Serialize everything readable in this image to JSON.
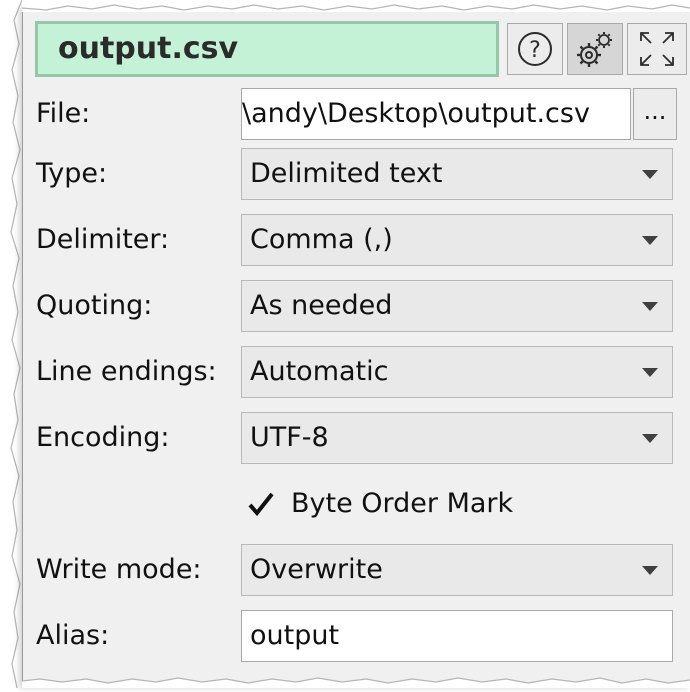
{
  "title": "output.csv",
  "toolbar": {
    "help_icon": "help-circle-icon",
    "settings_icon": "gears-icon",
    "expand_icon": "expand-arrows-icon"
  },
  "rows": {
    "file": {
      "label": "File:",
      "value": "\\andy\\Desktop\\output.csv",
      "browse": "..."
    },
    "type": {
      "label": "Type:",
      "value": "Delimited text"
    },
    "delimiter": {
      "label": "Delimiter:",
      "value": "Comma (,)"
    },
    "quoting": {
      "label": "Quoting:",
      "value": "As needed"
    },
    "line_endings": {
      "label": "Line endings:",
      "value": "Automatic"
    },
    "encoding": {
      "label": "Encoding:",
      "value": "UTF-8"
    },
    "bom": {
      "label": "Byte Order Mark",
      "checked": true
    },
    "write_mode": {
      "label": "Write mode:",
      "value": "Overwrite"
    },
    "alias": {
      "label": "Alias:",
      "value": "output"
    }
  },
  "colors": {
    "title_bg": "#c3f2d6",
    "title_border": "#95c7a8",
    "panel_bg": "#f0f0f0"
  }
}
